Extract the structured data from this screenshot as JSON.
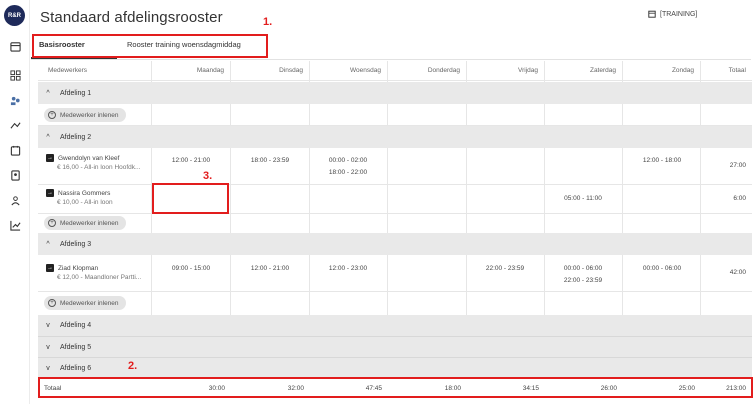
{
  "app": {
    "logo": "R&R",
    "title": "Standaard afdelingsrooster",
    "environment_label": "[TRAINING]"
  },
  "rail_icons": [
    "calendar-icon",
    "grid-icon",
    "people-icon",
    "shuffle-icon",
    "calendar-small-icon",
    "contacts-icon",
    "team-icon",
    "chart-icon"
  ],
  "tabs": [
    {
      "label": "Basisrooster",
      "active": true
    },
    {
      "label": "Rooster training woensdagmiddag",
      "active": false
    }
  ],
  "columns": [
    "Medewerkers",
    "Maandag",
    "Dinsdag",
    "Woensdag",
    "Donderdag",
    "Vrijdag",
    "Zaterdag",
    "Zondag",
    "Totaal"
  ],
  "borrow_label": "Medewerker inlenen",
  "departments": [
    {
      "name": "Afdeling 1",
      "expanded": true,
      "employees": []
    },
    {
      "name": "Afdeling 2",
      "expanded": true,
      "employees": [
        {
          "name": "Gwendolyn van Kleef",
          "sub": "€ 16,00 - All-in loon Hoofdk...",
          "shifts": {
            "Maandag": [
              "12:00 - 21:00"
            ],
            "Dinsdag": [
              "18:00 - 23:59"
            ],
            "Woensdag": [
              "00:00 - 02:00",
              "18:00 - 22:00"
            ],
            "Zondag": [
              "12:00 - 18:00"
            ]
          },
          "total": "27:00"
        },
        {
          "name": "Nassira Gommers",
          "sub": "€ 10,00 - All-in loon",
          "shifts": {
            "Zaterdag": [
              "05:00 - 11:00"
            ]
          },
          "total": "6:00"
        }
      ]
    },
    {
      "name": "Afdeling 3",
      "expanded": true,
      "employees": [
        {
          "name": "Ziad Klopman",
          "sub": "€ 12,00 - Maandloner Partti...",
          "shifts": {
            "Maandag": [
              "09:00 - 15:00"
            ],
            "Dinsdag": [
              "12:00 - 21:00"
            ],
            "Woensdag": [
              "12:00 - 23:00"
            ],
            "Vrijdag": [
              "22:00 - 23:59"
            ],
            "Zaterdag": [
              "00:00 - 06:00",
              "22:00 - 23:59"
            ],
            "Zondag": [
              "00:00 - 06:00"
            ]
          },
          "total": "42:00"
        }
      ]
    },
    {
      "name": "Afdeling 4",
      "expanded": false
    },
    {
      "name": "Afdeling 5",
      "expanded": false
    },
    {
      "name": "Afdeling 6",
      "expanded": true
    }
  ],
  "totals": {
    "label": "Totaal",
    "values": [
      "30:00",
      "32:00",
      "47:45",
      "18:00",
      "34:15",
      "26:00",
      "25:00",
      "213:00"
    ]
  },
  "annotations": {
    "one": "1.",
    "two": "2.",
    "three": "3.",
    "color": "#e21d1d"
  },
  "colors": {
    "logo_bg": "#1e2a5a",
    "dept_row_bg": "#e9e9e9",
    "annotation_red": "#e21d1d"
  }
}
